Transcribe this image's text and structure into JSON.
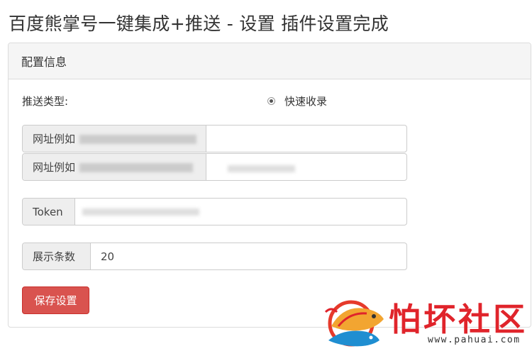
{
  "page_title": "百度熊掌号一键集成+推送 - 设置 插件设置完成",
  "panel": {
    "heading": "配置信息",
    "push_type_label": "推送类型:",
    "push_option": "快速收录",
    "url_fields": [
      {
        "label": "网址例如"
      },
      {
        "label": "网址例如"
      }
    ],
    "token_label": "Token",
    "count_label": "展示条数",
    "count_value": "20",
    "save_button": "保存设置"
  },
  "watermark": {
    "brand": "怕坏社区",
    "url": "www.pahuai.com"
  }
}
